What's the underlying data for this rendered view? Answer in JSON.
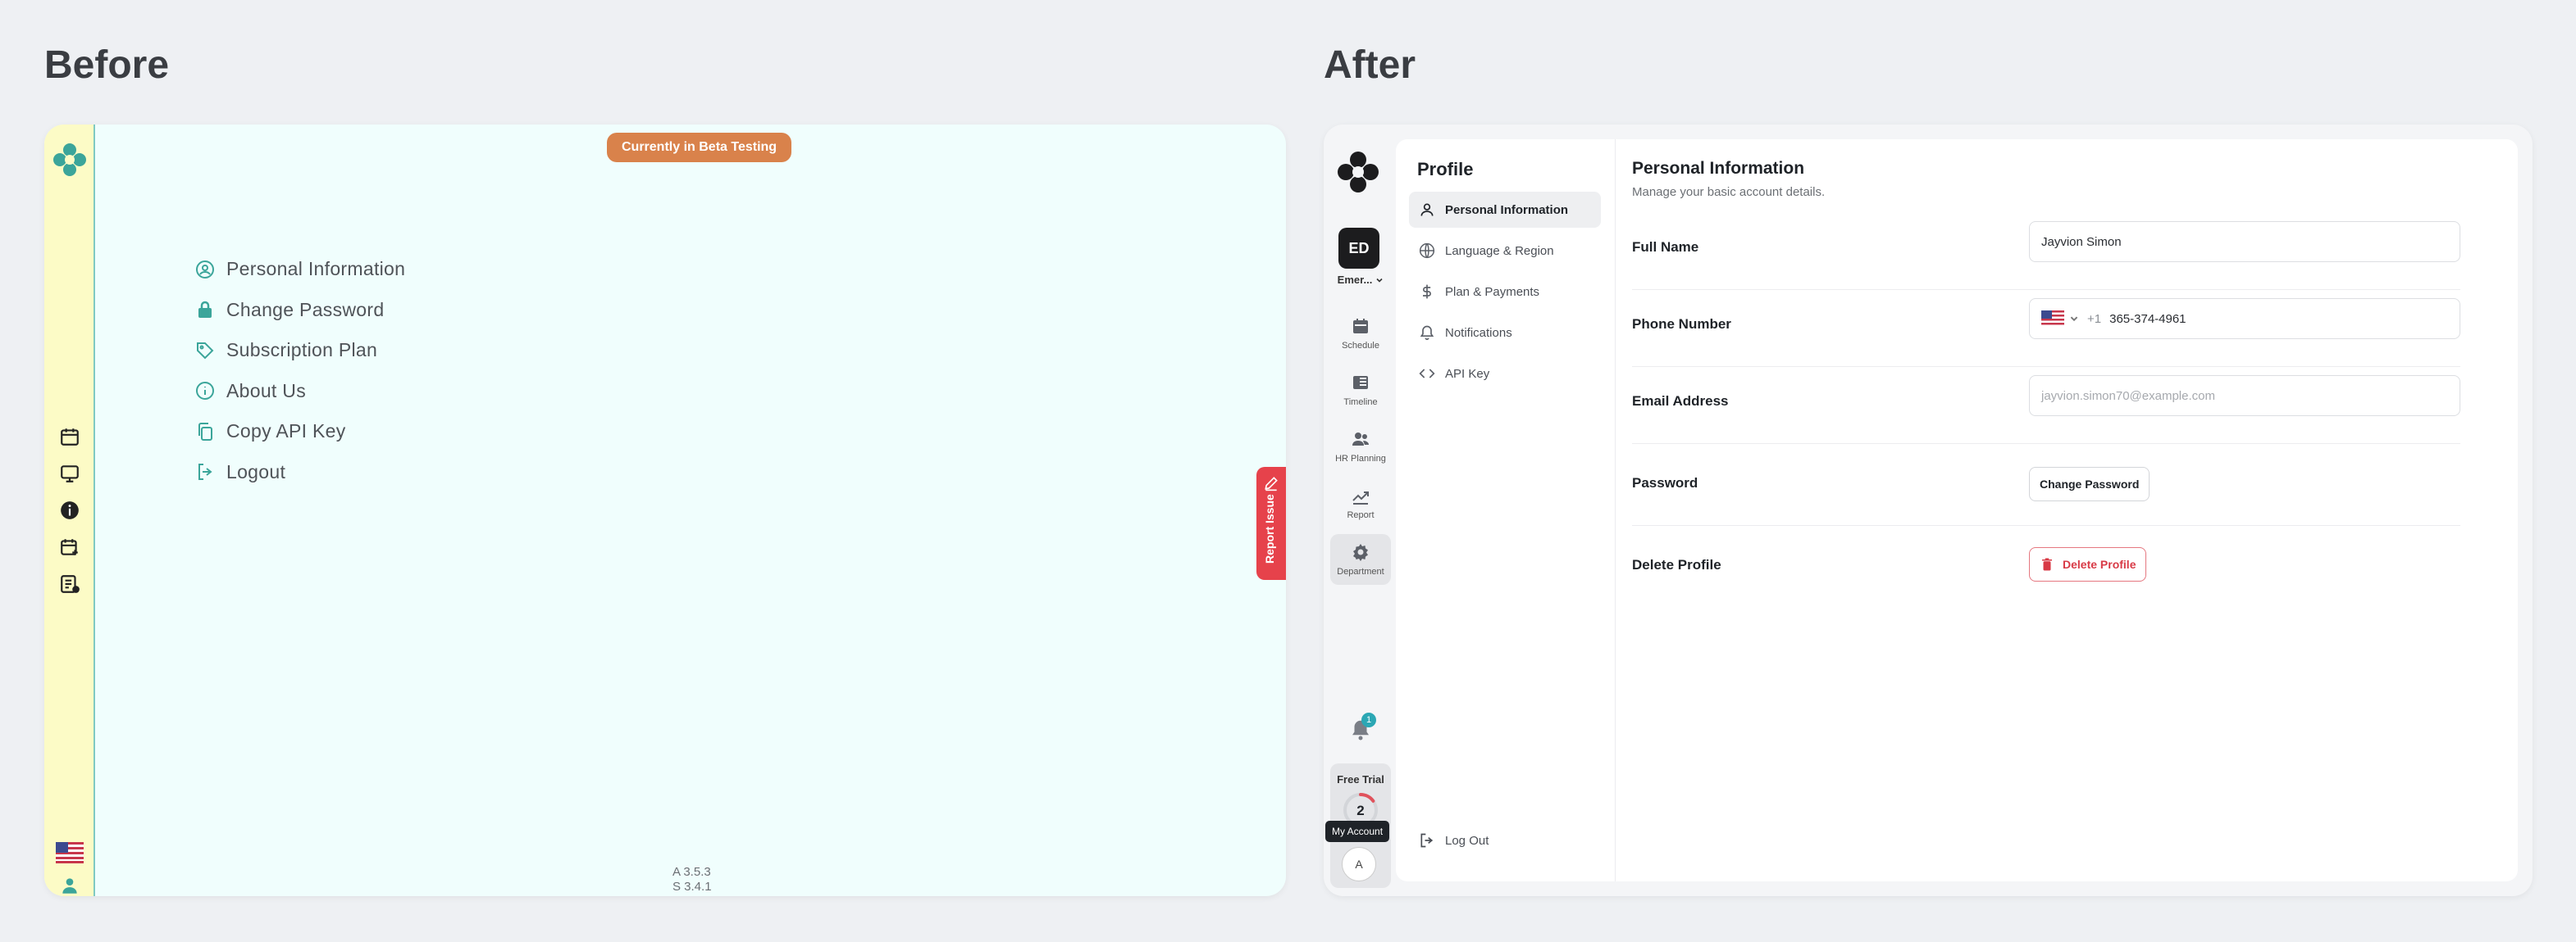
{
  "headings": {
    "before": "Before",
    "after": "After"
  },
  "before": {
    "beta_badge": "Currently in Beta Testing",
    "menu": [
      {
        "label": "Personal Information",
        "icon": "user-circle-icon"
      },
      {
        "label": "Change Password",
        "icon": "lock-icon"
      },
      {
        "label": "Subscription Plan",
        "icon": "tag-icon"
      },
      {
        "label": "About Us",
        "icon": "info-icon"
      },
      {
        "label": "Copy API Key",
        "icon": "copy-icon"
      },
      {
        "label": "Logout",
        "icon": "logout-icon"
      }
    ],
    "report_issue": "Report Issue",
    "version_a": "A 3.5.3",
    "version_s": "S 3.4.1",
    "colors": {
      "sidebar": "#fcfbc6",
      "canvas": "#f0fefd",
      "badge": "#d9824b",
      "report": "#e6424b",
      "teal": "#2a9d8f"
    }
  },
  "after": {
    "org": {
      "initials": "ED",
      "name": "Emer..."
    },
    "rail": [
      {
        "label": "Schedule",
        "icon": "calendar-icon"
      },
      {
        "label": "Timeline",
        "icon": "timeline-icon"
      },
      {
        "label": "HR Planning",
        "icon": "people-icon"
      },
      {
        "label": "Report",
        "icon": "chart-icon"
      },
      {
        "label": "Department",
        "icon": "gear-icon"
      }
    ],
    "notifications_count": "1",
    "trial": {
      "label": "Free Trial",
      "days": "2",
      "fraction": 0.15
    },
    "account": {
      "initial": "A",
      "tooltip": "My Account"
    },
    "profile": {
      "title": "Profile",
      "nav": [
        {
          "label": "Personal Information",
          "icon": "user-icon"
        },
        {
          "label": "Language & Region",
          "icon": "globe-icon"
        },
        {
          "label": "Plan & Payments",
          "icon": "dollar-icon"
        },
        {
          "label": "Notifications",
          "icon": "bell-icon"
        },
        {
          "label": "API Key",
          "icon": "code-icon"
        }
      ],
      "logout": "Log Out"
    },
    "section": {
      "title": "Personal Information",
      "subtitle": "Manage your basic account details.",
      "full_name_label": "Full Name",
      "full_name_value": "Jayvion Simon",
      "phone_label": "Phone Number",
      "phone_code": "+1",
      "phone_value": "365-374-4961",
      "email_label": "Email Address",
      "email_placeholder": "jayvion.simon70@example.com",
      "password_label": "Password",
      "change_password": "Change Password",
      "delete_label": "Delete Profile",
      "delete_button": "Delete Profile"
    },
    "colors": {
      "danger": "#d83a46",
      "badge": "#2ba7b4",
      "avatar": "#1c1c1e"
    }
  }
}
